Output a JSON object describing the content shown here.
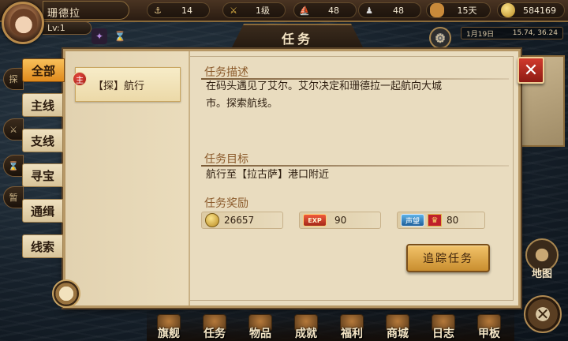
{
  "player": {
    "name": "珊德拉",
    "level": "Lv:1"
  },
  "resources": [
    {
      "icon": "anchor-icon",
      "value": "14"
    },
    {
      "icon": "rank-sword-icon",
      "value": "1级"
    },
    {
      "icon": "ship-icon",
      "value": "48"
    },
    {
      "icon": "crew-icon",
      "value": "48"
    },
    {
      "icon": "bread-icon",
      "value": "15天"
    },
    {
      "icon": "gold-coin-icon",
      "value": "584169"
    }
  ],
  "map_info": {
    "date": "1月19日",
    "coords": "15.74, 36.24"
  },
  "window": {
    "title": "任务",
    "close_label": "✕"
  },
  "tabs": [
    {
      "label": "全部",
      "active": true
    },
    {
      "label": "主线",
      "active": false
    },
    {
      "label": "支线",
      "active": false
    },
    {
      "label": "寻宝",
      "active": false
    },
    {
      "label": "通缉",
      "active": false
    },
    {
      "label": "线索",
      "active": false
    }
  ],
  "quest_list": [
    {
      "badge": "主",
      "name": "【探】航行"
    }
  ],
  "quest_detail": {
    "description_title": "任务描述",
    "description_line1": "在码头遇见了艾尔。艾尔决定和珊德拉一起航向大城",
    "description_line2": "市。探索航线。",
    "goal_title": "任务目标",
    "goal_text": "航行至【拉古萨】港口附近",
    "reward_title": "任务奖励",
    "rewards": {
      "gold": "26657",
      "exp_label": "EXP",
      "exp": "90",
      "fame_label": "声望",
      "fame": "80"
    },
    "track_button": "追踪任务"
  },
  "bottom_nav": [
    "旗舰",
    "任务",
    "物品",
    "成就",
    "福利",
    "商城",
    "日志",
    "甲板"
  ],
  "side_buttons": {
    "map": "地图",
    "left_edge": [
      "探",
      "暂"
    ]
  },
  "colors": {
    "active_tab": "#e08a1c",
    "close_button": "#d13a2d",
    "track_button": "#f2c36a",
    "parchment": "#e9dcbf"
  }
}
